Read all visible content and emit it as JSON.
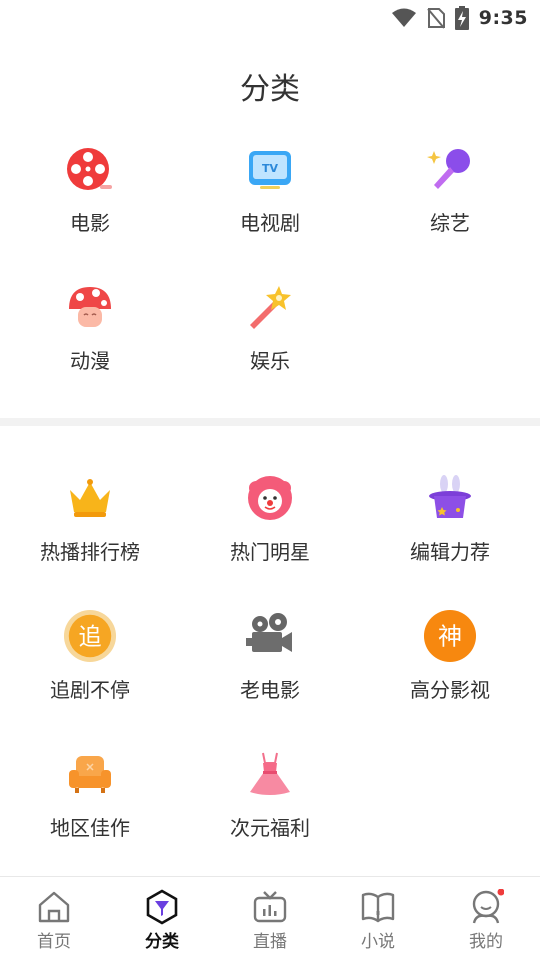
{
  "status_bar": {
    "time": "9:35",
    "icons": [
      "wifi-icon",
      "no-sim-icon",
      "battery-charging-icon"
    ]
  },
  "page": {
    "title": "分类"
  },
  "section1": {
    "items": [
      {
        "label": "电影",
        "icon": "film-reel-icon"
      },
      {
        "label": "电视剧",
        "icon": "tv-icon"
      },
      {
        "label": "综艺",
        "icon": "microphone-icon"
      },
      {
        "label": "动漫",
        "icon": "mushroom-icon"
      },
      {
        "label": "娱乐",
        "icon": "magic-wand-icon"
      }
    ]
  },
  "section2": {
    "items": [
      {
        "label": "热播排行榜",
        "icon": "crown-icon"
      },
      {
        "label": "热门明星",
        "icon": "clown-icon"
      },
      {
        "label": "编辑力荐",
        "icon": "magic-hat-icon"
      },
      {
        "label": "追剧不停",
        "icon": "chase-badge-icon",
        "badge_text": "追"
      },
      {
        "label": "老电影",
        "icon": "movie-camera-icon"
      },
      {
        "label": "高分影视",
        "icon": "god-badge-icon",
        "badge_text": "神"
      },
      {
        "label": "地区佳作",
        "icon": "sofa-icon"
      },
      {
        "label": "次元福利",
        "icon": "dress-icon"
      }
    ]
  },
  "tabbar": {
    "items": [
      {
        "label": "首页",
        "icon": "home-icon",
        "active": false
      },
      {
        "label": "分类",
        "icon": "category-icon",
        "active": true
      },
      {
        "label": "直播",
        "icon": "live-tv-icon",
        "active": false
      },
      {
        "label": "小说",
        "icon": "book-icon",
        "active": false
      },
      {
        "label": "我的",
        "icon": "profile-icon",
        "active": false,
        "has_dot": true
      }
    ]
  },
  "colors": {
    "accent_red": "#ef3b3b",
    "text": "#333333",
    "tab_inactive": "#777777",
    "divider": "#f2f2f2"
  }
}
